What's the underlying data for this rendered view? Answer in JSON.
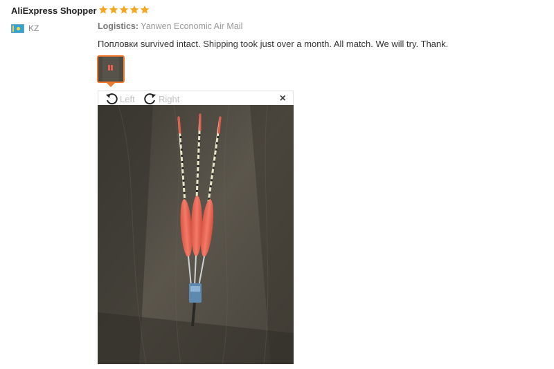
{
  "review": {
    "user_name": "AliExpress Shopper",
    "rating": 5,
    "rating_color": "#f5a623",
    "country_code": "KZ",
    "logistics_label": "Logistics:",
    "logistics_value": "Yanwen Economic Air Mail",
    "text": "Поплoвки survived intact. Shipping took just over a month. All match. We will try. Thank."
  },
  "viewer": {
    "rotate_left_label": "Left",
    "rotate_right_label": "Right",
    "close_symbol": "×"
  },
  "colors": {
    "accent": "#f07a2d",
    "float_body": "#f2695a",
    "wood_dark": "#4a463d"
  }
}
